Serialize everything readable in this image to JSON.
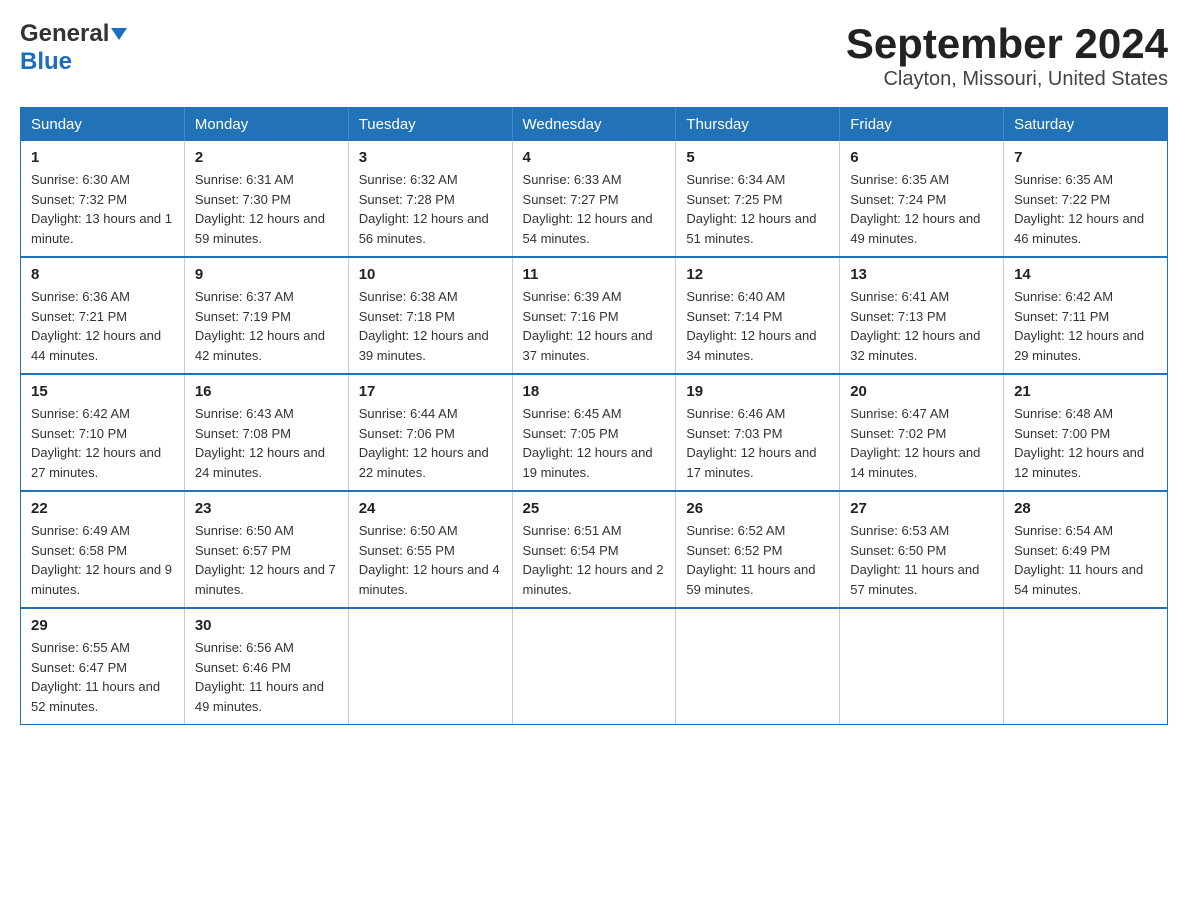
{
  "header": {
    "logo_general": "General",
    "logo_blue": "Blue",
    "title": "September 2024",
    "subtitle": "Clayton, Missouri, United States"
  },
  "calendar": {
    "days_of_week": [
      "Sunday",
      "Monday",
      "Tuesday",
      "Wednesday",
      "Thursday",
      "Friday",
      "Saturday"
    ],
    "weeks": [
      [
        {
          "day": "1",
          "sunrise": "6:30 AM",
          "sunset": "7:32 PM",
          "daylight": "13 hours and 1 minute."
        },
        {
          "day": "2",
          "sunrise": "6:31 AM",
          "sunset": "7:30 PM",
          "daylight": "12 hours and 59 minutes."
        },
        {
          "day": "3",
          "sunrise": "6:32 AM",
          "sunset": "7:28 PM",
          "daylight": "12 hours and 56 minutes."
        },
        {
          "day": "4",
          "sunrise": "6:33 AM",
          "sunset": "7:27 PM",
          "daylight": "12 hours and 54 minutes."
        },
        {
          "day": "5",
          "sunrise": "6:34 AM",
          "sunset": "7:25 PM",
          "daylight": "12 hours and 51 minutes."
        },
        {
          "day": "6",
          "sunrise": "6:35 AM",
          "sunset": "7:24 PM",
          "daylight": "12 hours and 49 minutes."
        },
        {
          "day": "7",
          "sunrise": "6:35 AM",
          "sunset": "7:22 PM",
          "daylight": "12 hours and 46 minutes."
        }
      ],
      [
        {
          "day": "8",
          "sunrise": "6:36 AM",
          "sunset": "7:21 PM",
          "daylight": "12 hours and 44 minutes."
        },
        {
          "day": "9",
          "sunrise": "6:37 AM",
          "sunset": "7:19 PM",
          "daylight": "12 hours and 42 minutes."
        },
        {
          "day": "10",
          "sunrise": "6:38 AM",
          "sunset": "7:18 PM",
          "daylight": "12 hours and 39 minutes."
        },
        {
          "day": "11",
          "sunrise": "6:39 AM",
          "sunset": "7:16 PM",
          "daylight": "12 hours and 37 minutes."
        },
        {
          "day": "12",
          "sunrise": "6:40 AM",
          "sunset": "7:14 PM",
          "daylight": "12 hours and 34 minutes."
        },
        {
          "day": "13",
          "sunrise": "6:41 AM",
          "sunset": "7:13 PM",
          "daylight": "12 hours and 32 minutes."
        },
        {
          "day": "14",
          "sunrise": "6:42 AM",
          "sunset": "7:11 PM",
          "daylight": "12 hours and 29 minutes."
        }
      ],
      [
        {
          "day": "15",
          "sunrise": "6:42 AM",
          "sunset": "7:10 PM",
          "daylight": "12 hours and 27 minutes."
        },
        {
          "day": "16",
          "sunrise": "6:43 AM",
          "sunset": "7:08 PM",
          "daylight": "12 hours and 24 minutes."
        },
        {
          "day": "17",
          "sunrise": "6:44 AM",
          "sunset": "7:06 PM",
          "daylight": "12 hours and 22 minutes."
        },
        {
          "day": "18",
          "sunrise": "6:45 AM",
          "sunset": "7:05 PM",
          "daylight": "12 hours and 19 minutes."
        },
        {
          "day": "19",
          "sunrise": "6:46 AM",
          "sunset": "7:03 PM",
          "daylight": "12 hours and 17 minutes."
        },
        {
          "day": "20",
          "sunrise": "6:47 AM",
          "sunset": "7:02 PM",
          "daylight": "12 hours and 14 minutes."
        },
        {
          "day": "21",
          "sunrise": "6:48 AM",
          "sunset": "7:00 PM",
          "daylight": "12 hours and 12 minutes."
        }
      ],
      [
        {
          "day": "22",
          "sunrise": "6:49 AM",
          "sunset": "6:58 PM",
          "daylight": "12 hours and 9 minutes."
        },
        {
          "day": "23",
          "sunrise": "6:50 AM",
          "sunset": "6:57 PM",
          "daylight": "12 hours and 7 minutes."
        },
        {
          "day": "24",
          "sunrise": "6:50 AM",
          "sunset": "6:55 PM",
          "daylight": "12 hours and 4 minutes."
        },
        {
          "day": "25",
          "sunrise": "6:51 AM",
          "sunset": "6:54 PM",
          "daylight": "12 hours and 2 minutes."
        },
        {
          "day": "26",
          "sunrise": "6:52 AM",
          "sunset": "6:52 PM",
          "daylight": "11 hours and 59 minutes."
        },
        {
          "day": "27",
          "sunrise": "6:53 AM",
          "sunset": "6:50 PM",
          "daylight": "11 hours and 57 minutes."
        },
        {
          "day": "28",
          "sunrise": "6:54 AM",
          "sunset": "6:49 PM",
          "daylight": "11 hours and 54 minutes."
        }
      ],
      [
        {
          "day": "29",
          "sunrise": "6:55 AM",
          "sunset": "6:47 PM",
          "daylight": "11 hours and 52 minutes."
        },
        {
          "day": "30",
          "sunrise": "6:56 AM",
          "sunset": "6:46 PM",
          "daylight": "11 hours and 49 minutes."
        },
        null,
        null,
        null,
        null,
        null
      ]
    ]
  }
}
